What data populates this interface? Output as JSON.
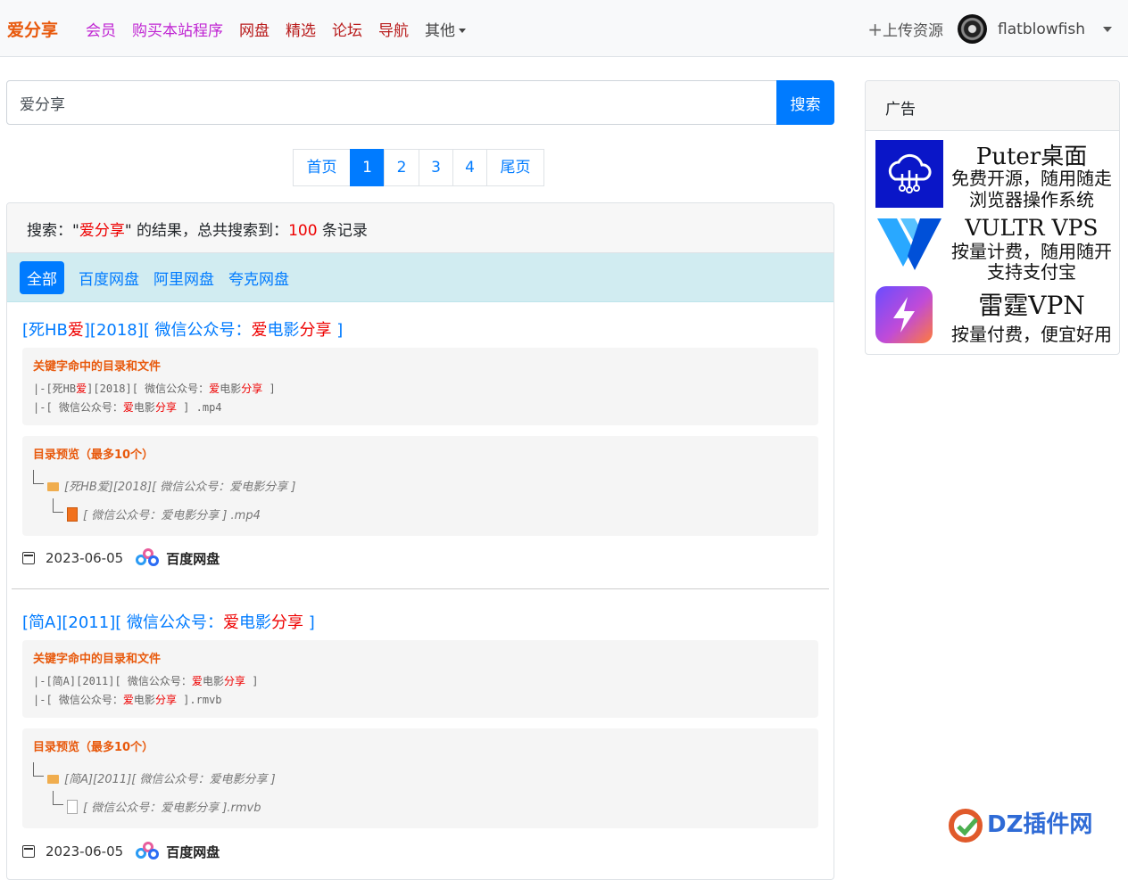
{
  "brand": "爱分享",
  "nav": [
    {
      "label": "会员",
      "color": "#c026d3"
    },
    {
      "label": "购买本站程序",
      "color": "#c026d3"
    },
    {
      "label": "网盘",
      "color": "#b91c1c"
    },
    {
      "label": "精选",
      "color": "#b91c1c"
    },
    {
      "label": "论坛",
      "color": "#b91c1c"
    },
    {
      "label": "导航",
      "color": "#b91c1c"
    },
    {
      "label": "其他",
      "color": "#444444"
    }
  ],
  "upload": "上传资源",
  "username": "flatblowfish",
  "search": {
    "value": "爱分享",
    "button": "搜索"
  },
  "pagination": [
    "首页",
    "1",
    "2",
    "3",
    "4",
    "尾页"
  ],
  "results_header": {
    "prefix": "搜索：\"",
    "keyword": "爱分享",
    "middle": "\" 的结果，总共搜索到：",
    "count": "100",
    "suffix": " 条记录"
  },
  "filters": [
    "全部",
    "百度网盘",
    "阿里网盘",
    "夸克网盘"
  ],
  "labels": {
    "keyword_files": "关键字命中的目录和文件",
    "preview": "目录预览（最多10个）"
  },
  "results": [
    {
      "title": {
        "a": "[死HB",
        "b": "爱",
        "c": "][2018][ 微信公众号：",
        "d": "爱",
        "e": "电影",
        "f": "分享",
        "g": " ]"
      },
      "hits": [
        {
          "a": "|-[死HB",
          "b": "爱",
          "c": "][2018][ 微信公众号：",
          "d": "爱",
          "e": "电影",
          "f": "分享",
          "g": " ]"
        },
        {
          "a": "|-[ 微信公众号：",
          "b": "爱",
          "c": "电影",
          "d": "分享",
          "e": " ] .mp4"
        }
      ],
      "tree": [
        "[死HB爱][2018][ 微信公众号：爱电影分享 ]",
        "[ 微信公众号：爱电影分享 ] .mp4"
      ],
      "date": "2023-06-05",
      "source": "百度网盘"
    },
    {
      "title": {
        "a": "[简A][2011][ 微信公众号：",
        "b": "爱",
        "c": "电影",
        "d": "分享",
        "e": " ]"
      },
      "hits": [
        {
          "a": "|-[简A][2011][ 微信公众号：",
          "b": "爱",
          "c": "电影",
          "d": "分享",
          "e": " ]"
        },
        {
          "a": "|-[ 微信公众号：",
          "b": "爱",
          "c": "电影",
          "d": "分享",
          "e": " ].rmvb"
        }
      ],
      "tree": [
        "[简A][2011][ 微信公众号：爱电影分享 ]",
        "[ 微信公众号：爱电影分享 ].rmvb"
      ],
      "date": "2023-06-05",
      "source": "百度网盘"
    }
  ],
  "ad": {
    "title": "广告",
    "items": [
      {
        "line1": "Puter桌面",
        "line2": "免费开源，随用随走",
        "line3": "浏览器操作系统"
      },
      {
        "line1": "VULTR VPS",
        "line2": "按量计费，随用随开",
        "line3": "支持支付宝"
      },
      {
        "line1": "雷霆VPN",
        "line2": "按量付费，便宜好用"
      }
    ]
  },
  "watermark": "DZ插件网"
}
